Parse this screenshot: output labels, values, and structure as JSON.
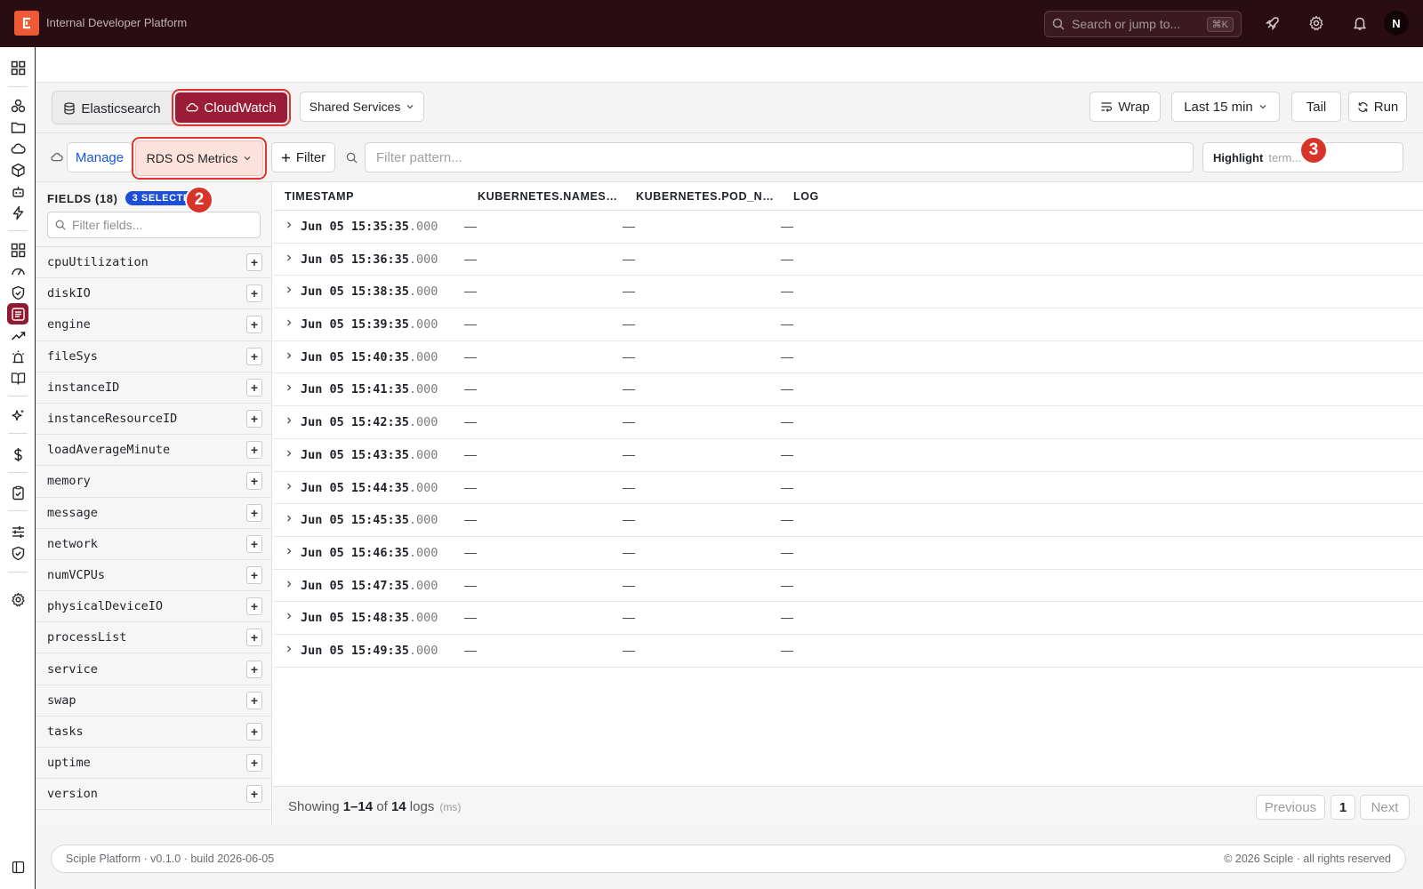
{
  "app": {
    "title": "Internal Developer Platform",
    "search_placeholder": "Search or jump to...",
    "search_shortcut": "⌘K",
    "avatar_initial": "N",
    "accent": "#9b1c36",
    "logo_color": "#ef5a36"
  },
  "toolbar": {
    "sources": [
      {
        "label": "Elasticsearch",
        "icon": "database-icon",
        "active": false
      },
      {
        "label": "CloudWatch",
        "icon": "cloud-icon",
        "active": true
      }
    ],
    "environment": "Shared Services",
    "wrap_label": "Wrap",
    "time_range": "Last 15 min",
    "tail_label": "Tail",
    "run_label": "Run"
  },
  "filter_row": {
    "manage_label": "Manage",
    "log_group": "RDS OS Metrics",
    "filter_label": "Filter",
    "pattern_placeholder": "Filter pattern...",
    "highlight_label": "Highlight",
    "highlight_placeholder": "term..."
  },
  "callouts": [
    "2",
    "3"
  ],
  "fields": {
    "title": "FIELDS (18)",
    "selected_badge": "3 SELECTED",
    "search_placeholder": "Filter fields...",
    "items": [
      "cpuUtilization",
      "diskIO",
      "engine",
      "fileSys",
      "instanceID",
      "instanceResourceID",
      "loadAverageMinute",
      "memory",
      "message",
      "network",
      "numVCPUs",
      "physicalDeviceIO",
      "processList",
      "service",
      "swap",
      "tasks",
      "uptime",
      "version"
    ]
  },
  "logs": {
    "columns": [
      "TIMESTAMP",
      "KUBERNETES.NAMES…",
      "KUBERNETES.POD_N…",
      "LOG"
    ],
    "empty_value": "—",
    "rows": [
      {
        "ts": "Jun 05 15:35:35",
        "ms": ".000"
      },
      {
        "ts": "Jun 05 15:36:35",
        "ms": ".000"
      },
      {
        "ts": "Jun 05 15:38:35",
        "ms": ".000"
      },
      {
        "ts": "Jun 05 15:39:35",
        "ms": ".000"
      },
      {
        "ts": "Jun 05 15:40:35",
        "ms": ".000"
      },
      {
        "ts": "Jun 05 15:41:35",
        "ms": ".000"
      },
      {
        "ts": "Jun 05 15:42:35",
        "ms": ".000"
      },
      {
        "ts": "Jun 05 15:43:35",
        "ms": ".000"
      },
      {
        "ts": "Jun 05 15:44:35",
        "ms": ".000"
      },
      {
        "ts": "Jun 05 15:45:35",
        "ms": ".000"
      },
      {
        "ts": "Jun 05 15:46:35",
        "ms": ".000"
      },
      {
        "ts": "Jun 05 15:47:35",
        "ms": ".000"
      },
      {
        "ts": "Jun 05 15:48:35",
        "ms": ".000"
      },
      {
        "ts": "Jun 05 15:49:35",
        "ms": ".000"
      }
    ],
    "footer": {
      "showing_prefix": "Showing ",
      "range": "1–14",
      "of": " of ",
      "total": "14",
      "suffix": " logs",
      "unit": "(ms)",
      "previous": "Previous",
      "page": "1",
      "next": "Next"
    }
  },
  "page_footer": {
    "left": "Sciple Platform · v0.1.0 · build 2026-06-05",
    "right": "© 2026 Sciple · all rights reserved"
  }
}
